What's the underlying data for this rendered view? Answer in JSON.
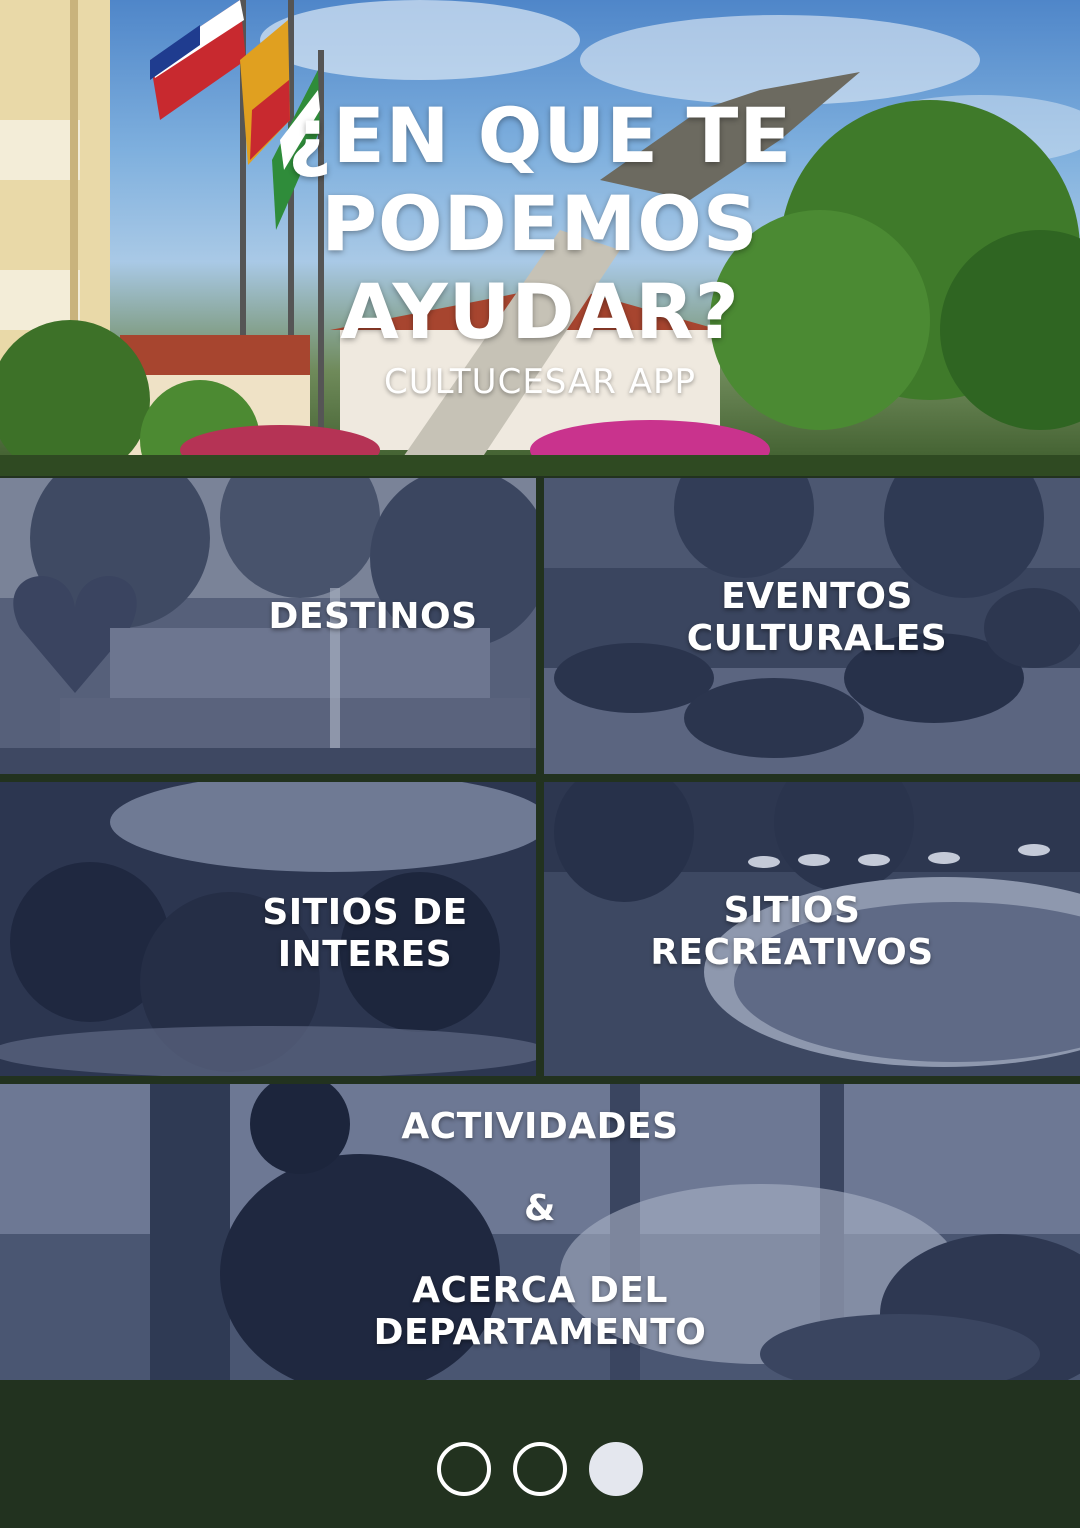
{
  "hero": {
    "title": "¿EN QUE TE PODEMOS AYUDAR?",
    "subtitle": "CULTUCESAR APP"
  },
  "tiles": [
    {
      "id": "destinos",
      "lines": [
        "DESTINOS"
      ]
    },
    {
      "id": "eventos",
      "lines": [
        "EVENTOS",
        "CULTURALES"
      ]
    },
    {
      "id": "interes",
      "lines": [
        "SITIOS DE",
        "INTERES"
      ]
    },
    {
      "id": "recreo",
      "lines": [
        "SITIOS",
        "RECREATIVOS"
      ]
    },
    {
      "id": "actividades",
      "lines": [
        "ACTIVIDADES",
        "&",
        "ACERCA DEL",
        "DEPARTAMENTO"
      ]
    }
  ],
  "pagination": {
    "total": 3,
    "active_index": 2
  },
  "colors": {
    "overlay": "#2d3a55",
    "footer": "#22321f",
    "dot_active": "#e4e7ee"
  }
}
